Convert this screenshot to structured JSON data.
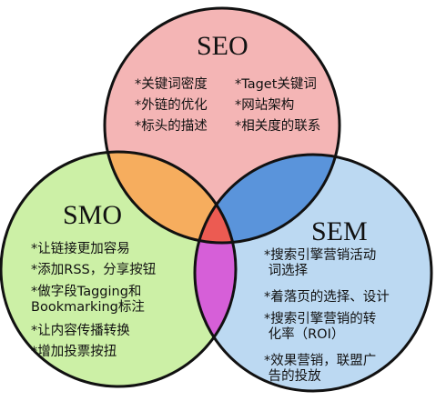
{
  "colors": {
    "seo_fill": "#f4b5b5",
    "smo_fill": "#ccf0a6",
    "sem_fill": "#bcd9f2",
    "seo_smo": "#f6ad5e",
    "seo_sem": "#5a94db",
    "smo_sem": "#d65fd8",
    "center": "#ec5b52",
    "outline": "#111111"
  },
  "seo": {
    "title": "SEO",
    "items_left": [
      "*关键词密度",
      "*外链的优化",
      "*标头的描述"
    ],
    "items_right": [
      "*Taget关键词",
      "*网站架构",
      "*相关度的联系"
    ]
  },
  "smo": {
    "title": "SMO",
    "items": [
      "*让链接更加容易",
      "*添加RSS，分享按钮",
      "*做字段Tagging和\nBookmarking标注",
      "*让内容传播转换",
      "*增加投票按扭"
    ]
  },
  "sem": {
    "title": "SEM",
    "items": [
      "*搜索引擎营销活动\n 词选择",
      "*着落页的选择、设计",
      "*搜索引擎营销的转\n 化率（ROI）",
      "*效果营销，联盟广\n 告的投放"
    ]
  }
}
